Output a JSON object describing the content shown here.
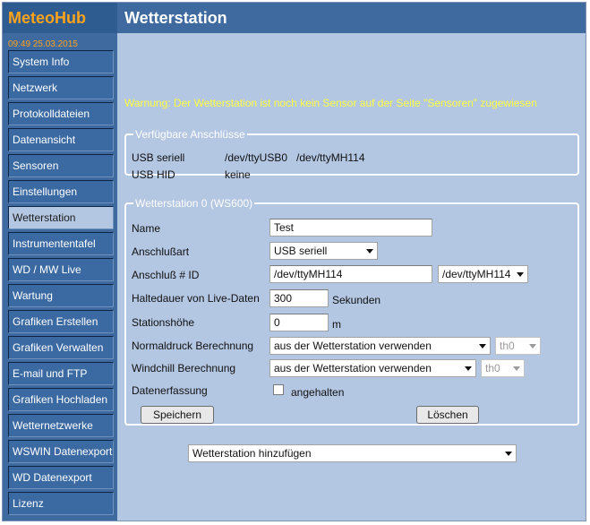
{
  "app": {
    "logo": "MeteoHub",
    "clock": "09:49   25.03.2015"
  },
  "header": {
    "title": "Wetterstation"
  },
  "sidebar": {
    "items": [
      {
        "label": "System Info"
      },
      {
        "label": "Netzwerk"
      },
      {
        "label": "Protokolldateien"
      },
      {
        "label": "Datenansicht"
      },
      {
        "label": "Sensoren"
      },
      {
        "label": "Einstellungen"
      },
      {
        "label": "Wetterstation",
        "active": true
      },
      {
        "label": "Instrumententafel"
      },
      {
        "label": "WD / MW Live"
      },
      {
        "label": "Wartung"
      },
      {
        "label": "Grafiken Erstellen"
      },
      {
        "label": "Grafiken Verwalten"
      },
      {
        "label": "E-mail und FTP"
      },
      {
        "label": "Grafiken Hochladen"
      },
      {
        "label": "Wetternetzwerke"
      },
      {
        "label": "WSWIN Datenexport"
      },
      {
        "label": "WD Datenexport"
      },
      {
        "label": "Lizenz"
      }
    ]
  },
  "warning": "Warnung: Der Wetterstation ist noch kein Sensor auf der Seite \"Sensoren\" zugewiesen",
  "ports": {
    "legend": "Verfügbare Anschlüsse",
    "usb_serial_label": "USB seriell",
    "usb_serial_value": "/dev/ttyUSB0   /dev/ttyMH114",
    "usb_hid_label": "USB HID",
    "usb_hid_value": "keine"
  },
  "station": {
    "legend": "Wetterstation 0 (WS600)",
    "name_label": "Name",
    "name_value": "Test",
    "connection_type_label": "Anschlußart",
    "connection_type_value": "USB seriell",
    "connection_id_label": "Anschluß # ID",
    "connection_id_value": "/dev/ttyMH114",
    "connection_id_select": "/dev/ttyMH114",
    "hold_time_label": "Haltedauer von Live-Daten",
    "hold_time_value": "300",
    "hold_time_unit": "Sekunden",
    "altitude_label": "Stationshöhe",
    "altitude_value": "0",
    "altitude_unit": "m",
    "pressure_label": "Normaldruck Berechnung",
    "pressure_value": "aus der Wetterstation verwenden",
    "pressure_sensor": "th0",
    "windchill_label": "Windchill Berechnung",
    "windchill_value": "aus der Wetterstation verwenden",
    "windchill_sensor": "th0",
    "recording_label": "Datenerfassung",
    "recording_checkbox_label": "angehalten",
    "save_label": "Speichern",
    "delete_label": "Löschen"
  },
  "add_station": {
    "value": "Wetterstation hinzufügen"
  },
  "colors": {
    "accent_orange": "#ffa31a",
    "warning_yellow": "#ffff3f",
    "sidebar_blue": "#3e6aa0",
    "content_bg": "#b3c6e2"
  }
}
